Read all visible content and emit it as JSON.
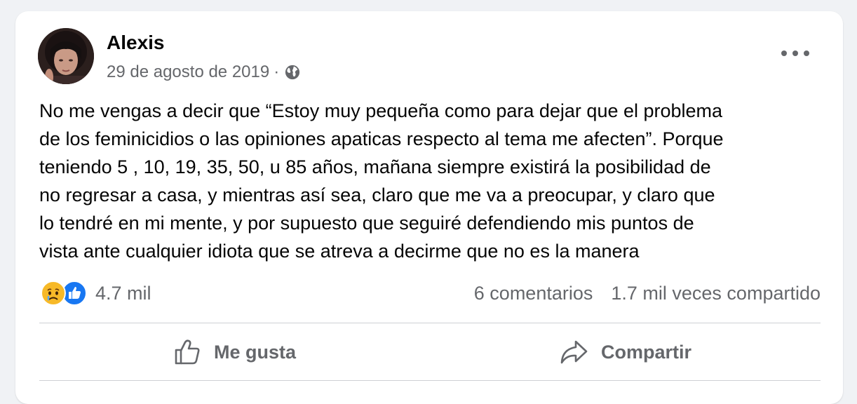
{
  "post": {
    "author": "Alexis",
    "date": "29 de agosto de 2019",
    "separator": "·",
    "privacy_icon": "globe-icon",
    "text": "No me vengas a decir que “Estoy muy pequeña como para dejar que el problema\nde los feminicidios o las opiniones apaticas respecto al tema me afecten”. Porque\nteniendo 5 , 10, 19, 35, 50, u 85 años, mañana siempre existirá la posibilidad de\nno regresar a casa, y mientras así sea, claro que me va a preocupar, y claro que\nlo tendré en mi mente, y por supuesto que seguiré defendiendo mis puntos de\nvista ante cualquier idiota que se atreva a decirme que no es la manera"
  },
  "stats": {
    "reaction_icons": [
      "sad-reaction-icon",
      "like-reaction-icon"
    ],
    "reactions_count": "4.7 mil",
    "comments": "6 comentarios",
    "shares": "1.7 mil veces compartido"
  },
  "actions": {
    "like_label": "Me gusta",
    "share_label": "Compartir"
  },
  "colors": {
    "background": "#f0f2f5",
    "card": "#ffffff",
    "secondary_text": "#65676b",
    "like_blue": "#1877f2",
    "sad_yellow": "#f7b928"
  }
}
